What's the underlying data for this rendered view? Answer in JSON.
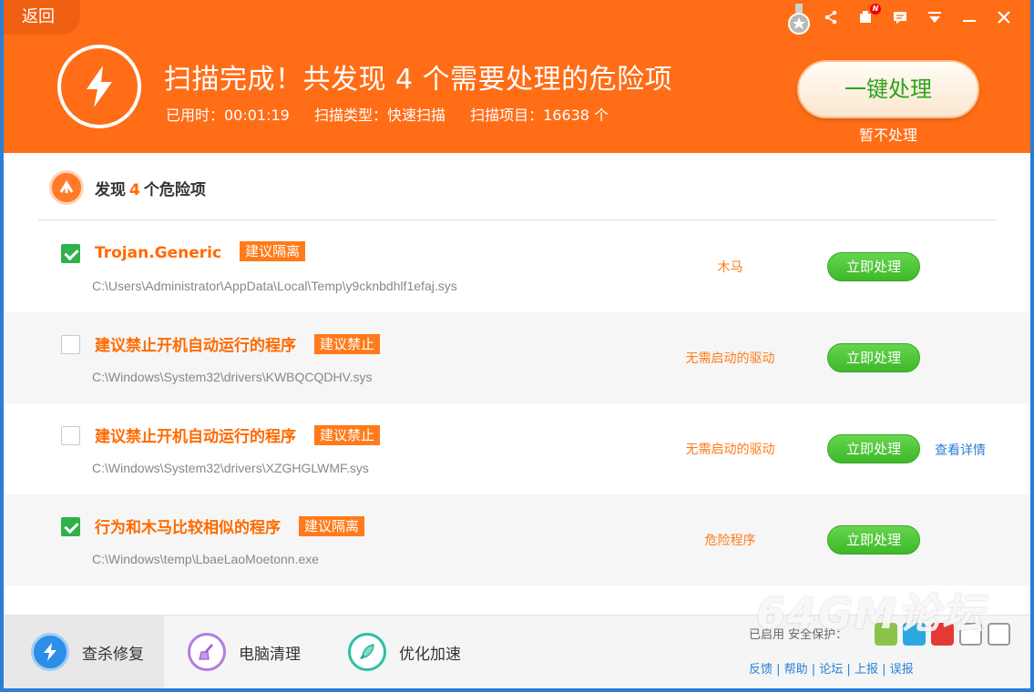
{
  "header": {
    "back_label": "返回",
    "headline": "扫描完成！共发现 4 个需要处理的危险项",
    "stats": {
      "time": "已用时：00:01:19",
      "type": "扫描类型：快速扫描",
      "items": "扫描项目：16638 个"
    },
    "primary_button": "一键处理",
    "skip_link": "暂不处理",
    "notification_badge": "N"
  },
  "section": {
    "prefix": "发现",
    "count": "4",
    "suffix": "个危险项"
  },
  "threats": [
    {
      "name": "Trojan.Generic",
      "tag": "建议隔离",
      "path": "C:\\Users\\Administrator\\AppData\\Local\\Temp\\y9cknbdhlf1efaj.sys",
      "type": "木马",
      "action": "立即处理",
      "checked": true
    },
    {
      "name": "建议禁止开机自动运行的程序",
      "tag": "建议禁止",
      "path": "C:\\Windows\\System32\\drivers\\KWBQCQDHV.sys",
      "type": "无需启动的驱动",
      "action": "立即处理",
      "checked": false
    },
    {
      "name": "建议禁止开机自动运行的程序",
      "tag": "建议禁止",
      "path": "C:\\Windows\\System32\\drivers\\XZGHGLWMF.sys",
      "type": "无需启动的驱动",
      "action": "立即处理",
      "detail": "查看详情",
      "checked": false
    },
    {
      "name": "行为和木马比较相似的程序",
      "tag": "建议隔离",
      "path": "C:\\Windows\\temp\\LbaeLaoMoetonn.exe",
      "type": "危险程序",
      "action": "立即处理",
      "checked": true
    }
  ],
  "footer": {
    "tabs": [
      {
        "label": "查杀修复"
      },
      {
        "label": "电脑清理"
      },
      {
        "label": "优化加速"
      }
    ],
    "right_text": "已启用 安全保护：",
    "right_links": "反馈 | 帮助 | 论坛 | 上报 | 误报"
  },
  "watermark": "64GM论坛",
  "colors": {
    "header": "#ff6d17",
    "accent": "#ff6a00",
    "green": "#3eb829",
    "link": "#2b7fd6"
  }
}
